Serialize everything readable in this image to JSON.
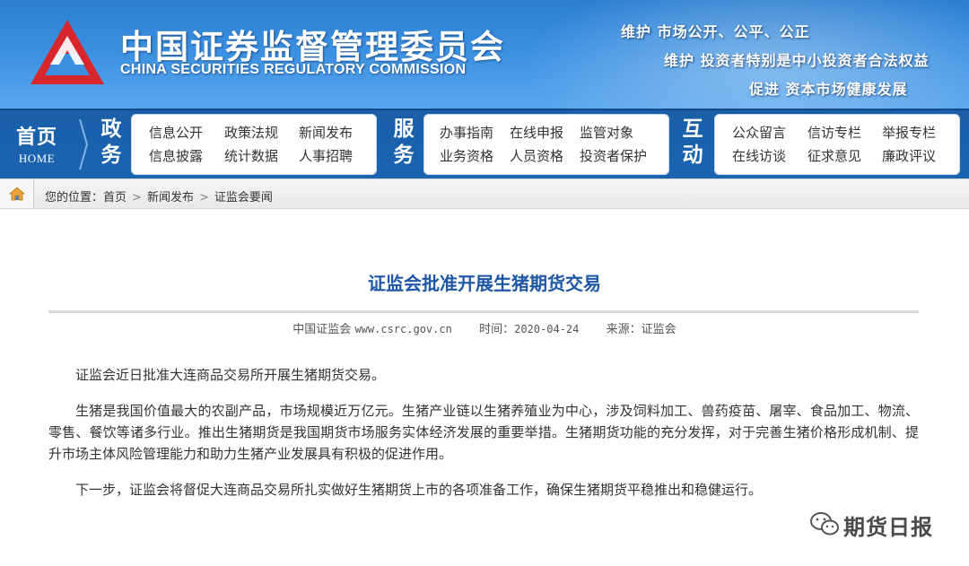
{
  "header": {
    "org_name_cn": "中国证券监督管理委员会",
    "org_name_en": "CHINA SECURITIES REGULATORY COMMISSION",
    "slogans": [
      "维护 市场公开、公平、公正",
      "维护 投资者特别是中小投资者合法权益",
      "促进 资本市场健康发展"
    ],
    "logo_icon": "csrc-logo-icon",
    "colors": {
      "banner": "#3a8fe0",
      "nav": "#1a5fa8",
      "logo_red": "#d7262c"
    }
  },
  "nav": {
    "home_cn": "首页",
    "home_en": "HOME",
    "groups": [
      {
        "label_1": "政",
        "label_2": "务",
        "links": [
          "信息公开",
          "政策法规",
          "新闻发布",
          "信息披露",
          "统计数据",
          "人事招聘"
        ]
      },
      {
        "label_1": "服",
        "label_2": "务",
        "links": [
          "办事指南",
          "在线申报",
          "监管对象",
          "业务资格",
          "人员资格",
          "投资者保护"
        ]
      },
      {
        "label_1": "互",
        "label_2": "动",
        "links": [
          "公众留言",
          "信访专栏",
          "举报专栏",
          "在线访谈",
          "征求意见",
          "廉政评议"
        ]
      }
    ]
  },
  "breadcrumb": {
    "prefix": "您的位置：",
    "items": [
      "首页",
      "新闻发布",
      "证监会要闻"
    ],
    "separator": ">",
    "home_icon": "house-icon"
  },
  "article": {
    "title": "证监会批准开展生猪期货交易",
    "source_label": "中国证监会",
    "site": "www.csrc.gov.cn",
    "time_label": "时间：",
    "date": "2020-04-24",
    "from_label": "来源：",
    "from": "证监会",
    "paragraphs": [
      "证监会近日批准大连商品交易所开展生猪期货交易。",
      "生猪是我国价值最大的农副产品，市场规模近万亿元。生猪产业链以生猪养殖业为中心，涉及饲料加工、兽药疫苗、屠宰、食品加工、物流、零售、餐饮等诸多行业。推出生猪期货是我国期货市场服务实体经济发展的重要举措。生猪期货功能的充分发挥，对于完善生猪价格形成机制、提升市场主体风险管理能力和助力生猪产业发展具有积极的促进作用。",
      "下一步，证监会将督促大连商品交易所扎实做好生猪期货上市的各项准备工作，确保生猪期货平稳推出和稳健运行。"
    ],
    "title_color": "#1d57a6"
  },
  "watermark": {
    "text": "期货日报",
    "icon": "wechat-icon"
  }
}
